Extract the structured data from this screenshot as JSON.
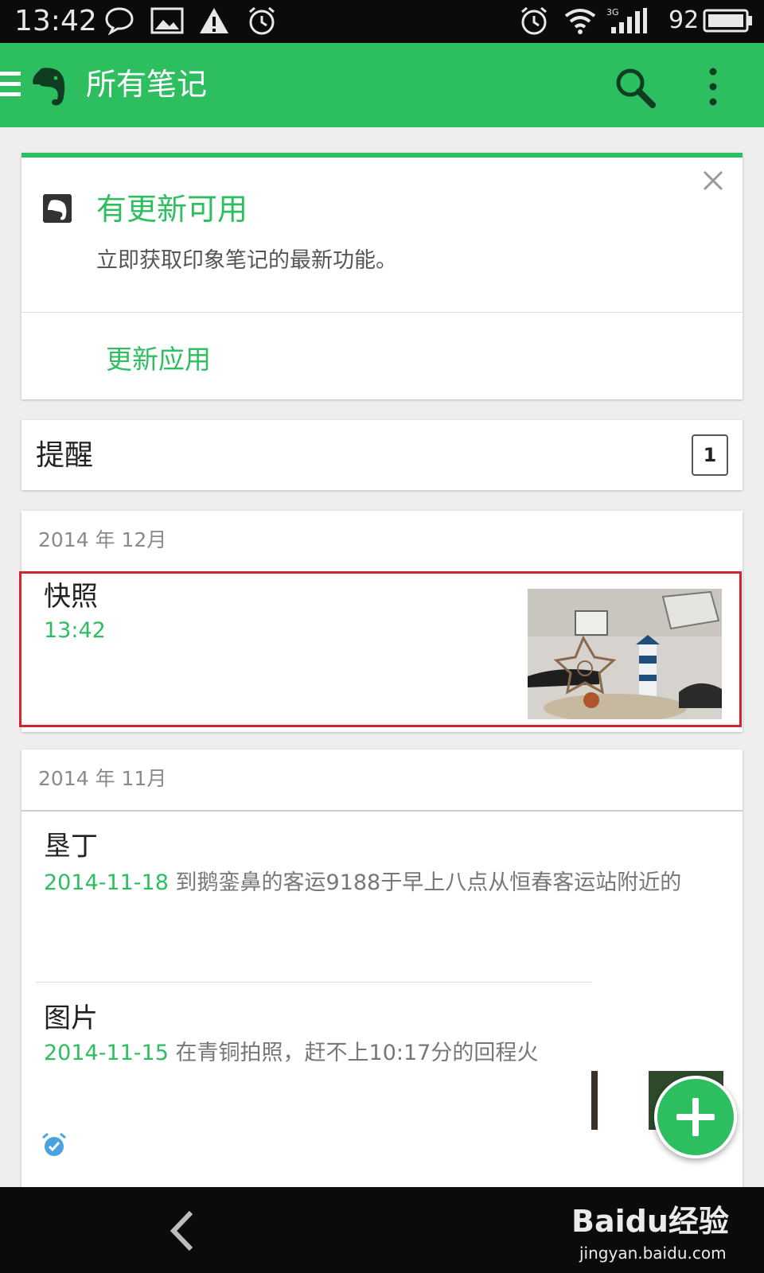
{
  "status_bar": {
    "time": "13:42",
    "battery": "92",
    "network": "3G",
    "icons": [
      "chat-icon",
      "image-icon",
      "warning-icon",
      "alarm-icon",
      "alarm-clock-icon",
      "wifi-icon",
      "signal-icon",
      "battery-icon"
    ]
  },
  "app_bar": {
    "title": "所有笔记",
    "icons": [
      "menu-icon",
      "evernote-logo",
      "search-icon",
      "more-vert-icon"
    ],
    "accent_color": "#2dbe60"
  },
  "update_card": {
    "title": "有更新可用",
    "description": "立即获取印象笔记的最新功能。",
    "action": "更新应用",
    "close_glyph": "×"
  },
  "reminders": {
    "label": "提醒",
    "count": "1"
  },
  "sections": [
    {
      "month": "2014 年 12月",
      "notes": [
        {
          "title": "快照",
          "time": "13:42",
          "highlight_color": "#d5232f"
        }
      ]
    },
    {
      "month": "2014 年 11月",
      "notes": [
        {
          "title": "垦丁",
          "date": "2014-11-18",
          "snippet": "到鹅銮鼻的客运9188于早上八点从恒春客运站附近的"
        },
        {
          "title": "图片",
          "date": "2014-11-15",
          "snippet": "在青铜拍照，赶不上10:17分的回程火"
        }
      ]
    }
  ],
  "fab": {
    "icon": "plus-icon"
  },
  "nav_bar": {
    "icons": [
      "back-icon"
    ]
  },
  "watermark": {
    "logo": "Baidu经验",
    "site": "jingyan.baidu.com"
  }
}
